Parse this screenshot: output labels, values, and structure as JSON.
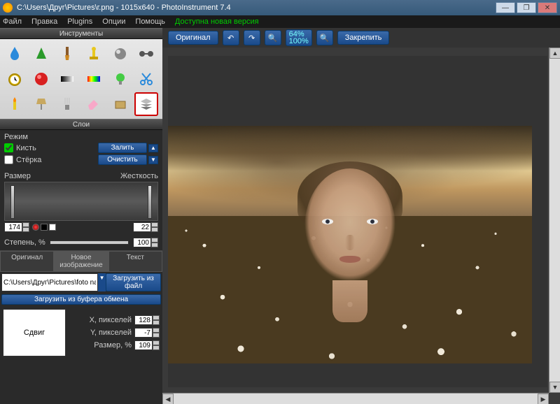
{
  "window": {
    "title": "C:\\Users\\Друг\\Pictures\\г.png - 1015x640 - PhotoInstrument 7.4"
  },
  "menu": {
    "file": "Файл",
    "edit": "Правка",
    "plugins": "Plugins",
    "options": "Опции",
    "help": "Помощь",
    "new_version": "Доступна новая версия"
  },
  "panels": {
    "tools_title": "Инструменты",
    "layers_title": "Слои"
  },
  "mode": {
    "title": "Режим",
    "brush": "Кисть",
    "eraser": "Стёрка",
    "fill": "Залить",
    "clear": "Очистить"
  },
  "sliders": {
    "size_label": "Размер",
    "hardness_label": "Жесткость",
    "size_value": "174",
    "hardness_value": "22"
  },
  "strength": {
    "label": "Степень, %",
    "value": "100"
  },
  "tabs": {
    "original": "Оригинал",
    "new_image": "Новое изображение",
    "text": "Текст"
  },
  "file": {
    "path": "C:\\Users\\Друг\\Pictures\\foto na",
    "load_file": "Загрузить из файл",
    "load_clipboard": "Загрузить из буфера обмена"
  },
  "params": {
    "shift": "Сдвиг",
    "x_label": "X, пикселей",
    "y_label": "Y, пикселей",
    "size_label": "Размер, %",
    "x": "128",
    "y": "-7",
    "size": "109"
  },
  "toolbar": {
    "original": "Оригинал",
    "zoom1": "64%",
    "zoom2": "100%",
    "pin": "Закрепить"
  },
  "tool_icons": [
    "drop",
    "cone",
    "brush",
    "stamp",
    "orb",
    "barbell",
    "clock",
    "redcircle",
    "gradient-bw",
    "gradient-color",
    "bulb-green",
    "scissors",
    "candle",
    "lamp",
    "cfl",
    "eraser",
    "patch",
    "layers"
  ]
}
